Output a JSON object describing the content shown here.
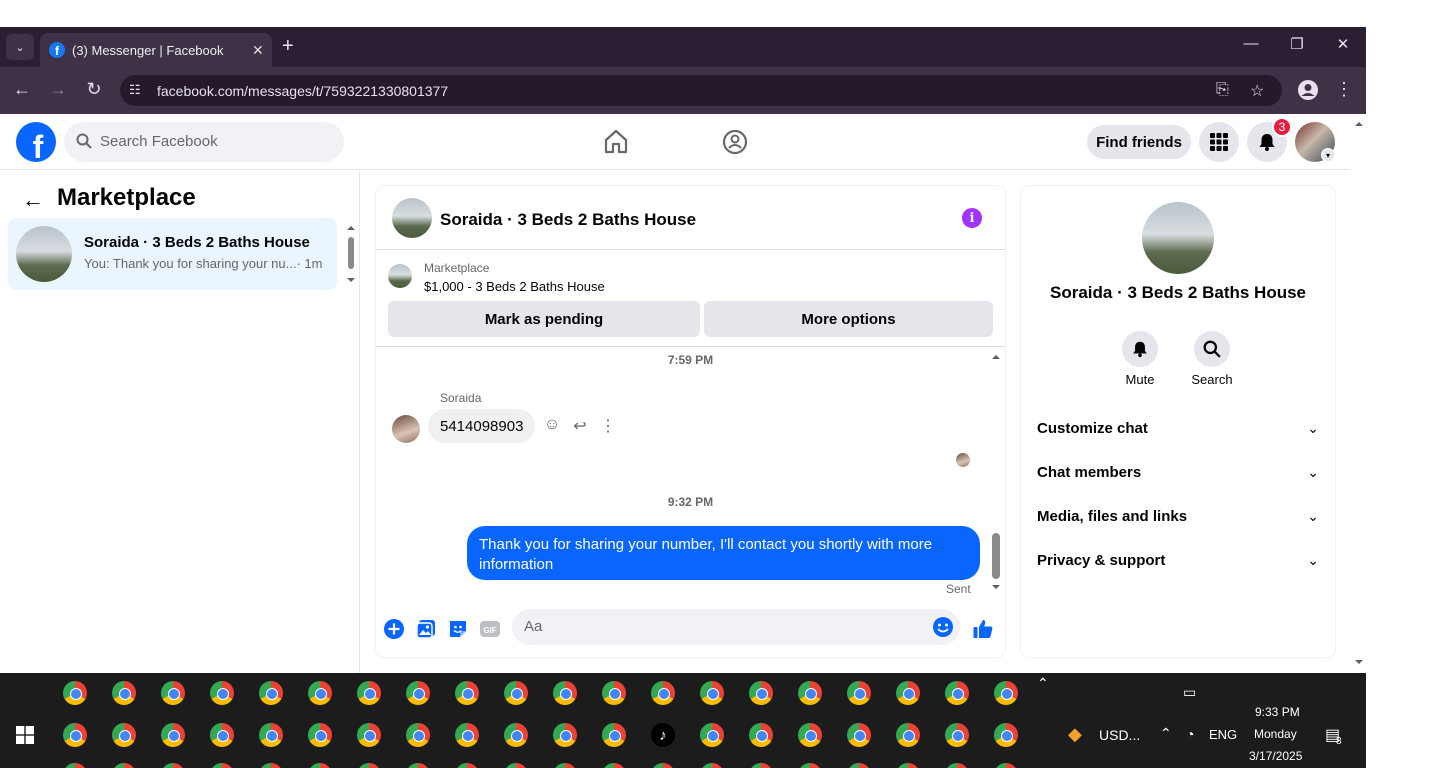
{
  "browser": {
    "tab_title": "(3) Messenger | Facebook",
    "url": "facebook.com/messages/t/7593221330801377"
  },
  "header": {
    "search_placeholder": "Search Facebook",
    "find_friends": "Find friends",
    "notification_count": "3"
  },
  "left_panel": {
    "title": "Marketplace",
    "conversation": {
      "name": "Soraida · 3 Beds 2 Baths House",
      "preview": "You: Thank you for sharing your nu...",
      "time": "· 1m"
    }
  },
  "chat": {
    "title": "Soraida · 3 Beds 2 Baths House",
    "marketplace_label": "Marketplace",
    "listing": "$1,000 - 3 Beds 2 Baths House",
    "mark_pending": "Mark as pending",
    "more_options": "More options",
    "timestamp_1": "7:59 PM",
    "sender_name": "Soraida",
    "incoming_message": "5414098903",
    "timestamp_2": "9:32 PM",
    "outgoing_message": "Thank you for sharing your number, I'll contact you shortly with more information",
    "sent_status": "Sent",
    "composer_placeholder": "Aa"
  },
  "right_panel": {
    "name": "Soraida · 3 Beds 2 Baths House",
    "mute": "Mute",
    "search": "Search",
    "sections": [
      "Customize chat",
      "Chat members",
      "Media, files and links",
      "Privacy & support"
    ]
  },
  "taskbar": {
    "app_label": "USD...",
    "lang": "ENG",
    "time": "9:33 PM",
    "day": "Monday",
    "date": "3/17/2025",
    "notif_count": "8"
  },
  "colors": {
    "facebook_blue": "#0866ff",
    "info_purple": "#a033ff",
    "badge_red": "#e41e3f",
    "tab_bar": "#2b2033"
  }
}
